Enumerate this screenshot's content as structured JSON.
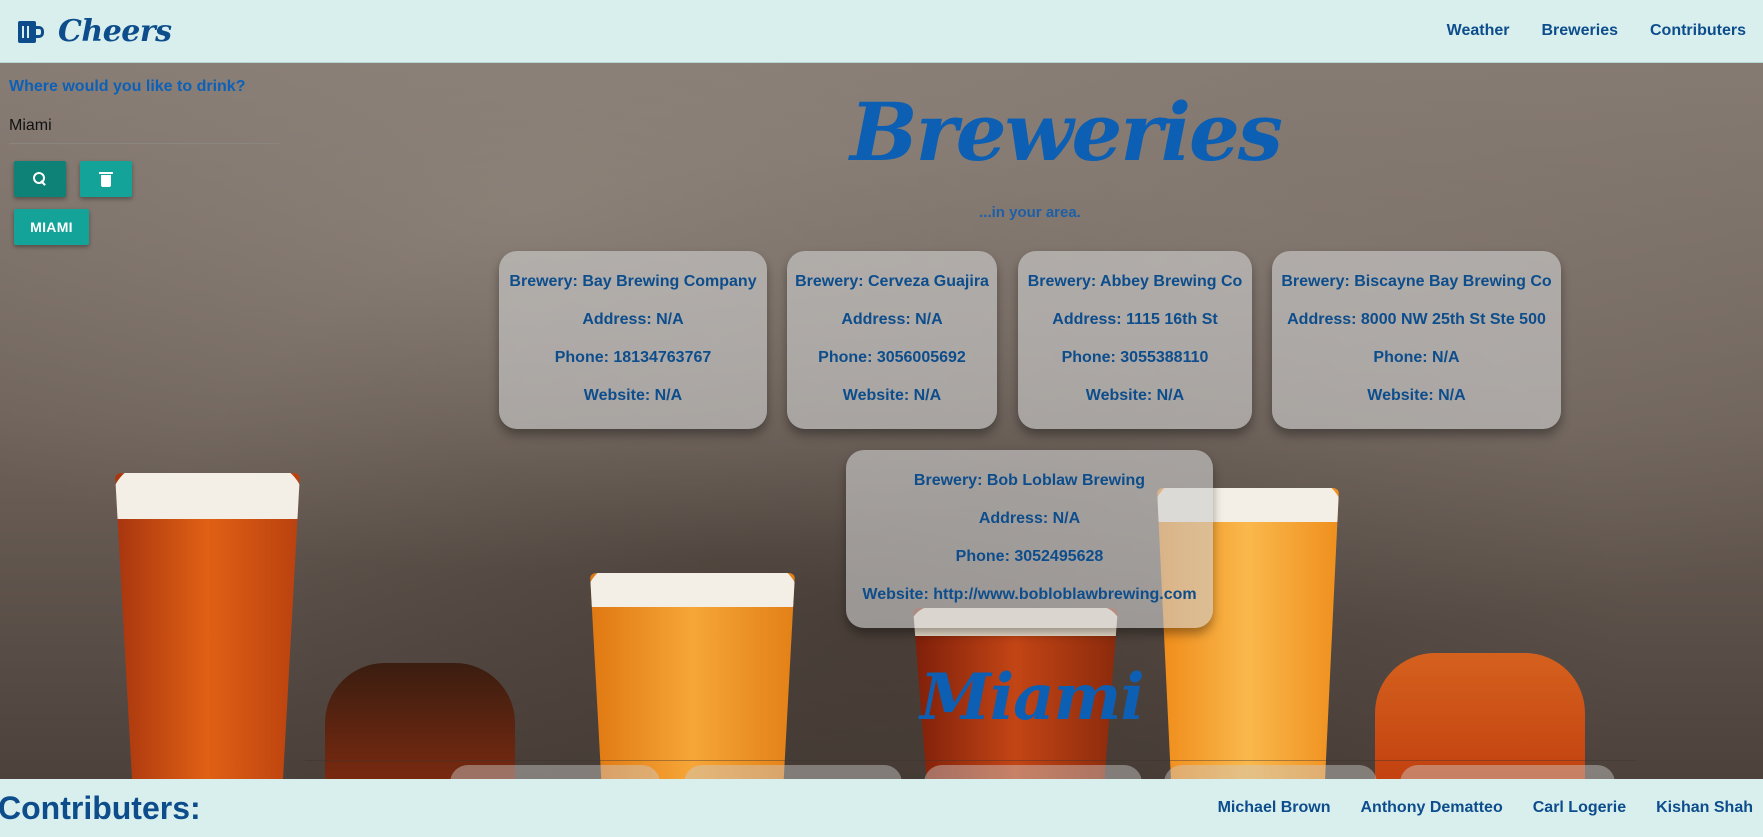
{
  "header": {
    "brand": "Cheers",
    "nav": [
      "Weather",
      "Breweries",
      "Contributers"
    ]
  },
  "search": {
    "label": "Where would you like to drink?",
    "value": "Miami",
    "search_icon": "search-icon",
    "clear_icon": "trash-icon",
    "history": [
      "MIAMI"
    ]
  },
  "main": {
    "title": "Breweries",
    "subtitle": "...in your area.",
    "city_title": "Miami"
  },
  "breweries": [
    {
      "name": "Brewery: Bay Brewing Company",
      "address": "Address: N/A",
      "phone": "Phone: 18134763767",
      "website": "Website: N/A"
    },
    {
      "name": "Brewery: Cerveza Guajira",
      "address": "Address: N/A",
      "phone": "Phone: 3056005692",
      "website": "Website: N/A"
    },
    {
      "name": "Brewery: Abbey Brewing Co",
      "address": "Address: 1115 16th St",
      "phone": "Phone: 3055388110",
      "website": "Website: N/A"
    },
    {
      "name": "Brewery: Biscayne Bay Brewing Co",
      "address": "Address: 8000 NW 25th St Ste 500",
      "phone": "Phone: N/A",
      "website": "Website: N/A"
    },
    {
      "name": "Brewery: Bob Loblaw Brewing",
      "address": "Address: N/A",
      "phone": "Phone: 3052495628",
      "website": "Website: http://www.bobloblawbrewing.com"
    }
  ],
  "footer": {
    "title": "Contributers:",
    "names": [
      "Michael Brown",
      "Anthony Dematteo",
      "Carl Logerie",
      "Kishan Shah"
    ]
  },
  "colors": {
    "header_bg": "#d9efee",
    "accent_text": "#0d4d8c",
    "button": "#13a398"
  }
}
